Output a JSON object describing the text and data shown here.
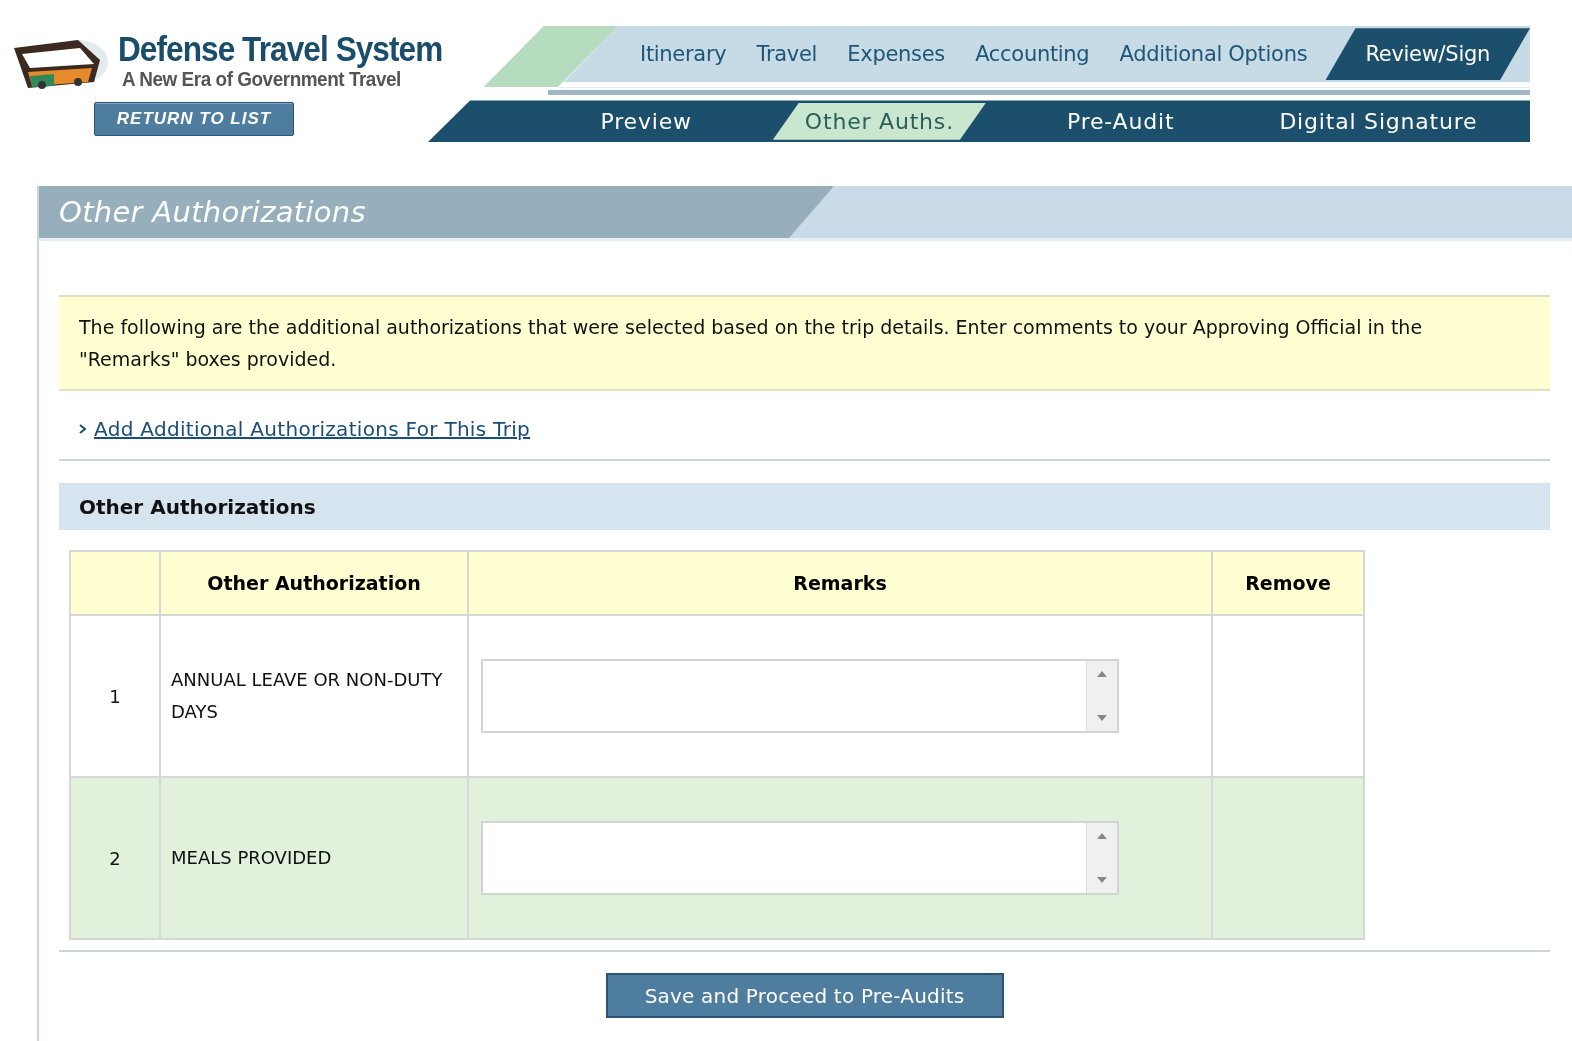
{
  "header": {
    "title": "Defense Travel System",
    "subtitle": "A New Era of Government Travel",
    "return_button": "RETURN TO LIST"
  },
  "main_tabs": [
    {
      "label": "Itinerary",
      "selected": false
    },
    {
      "label": "Travel",
      "selected": false
    },
    {
      "label": "Expenses",
      "selected": false
    },
    {
      "label": "Accounting",
      "selected": false
    },
    {
      "label": "Additional Options",
      "selected": false
    },
    {
      "label": "Review/Sign",
      "selected": true
    }
  ],
  "sub_tabs": [
    {
      "label": "Preview",
      "selected": false
    },
    {
      "label": "Other Auths.",
      "selected": true
    },
    {
      "label": "Pre-Audit",
      "selected": false
    },
    {
      "label": "Digital Signature",
      "selected": false
    }
  ],
  "page_title": "Other Authorizations",
  "notice": "The following are the additional authorizations that were selected based on the trip details. Enter comments to your Approving Official in the \"Remarks\" boxes provided.",
  "add_link": "Add Additional Authorizations For This Trip",
  "section_title": "Other Authorizations",
  "table": {
    "columns": [
      "Other Authorization",
      "Remarks",
      "Remove"
    ],
    "rows": [
      {
        "number": "1",
        "authorization": "ANNUAL LEAVE OR NON-DUTY DAYS"
      },
      {
        "number": "2",
        "authorization": "MEALS PROVIDED"
      }
    ]
  },
  "save_button": "Save and Proceed to Pre-Audits"
}
